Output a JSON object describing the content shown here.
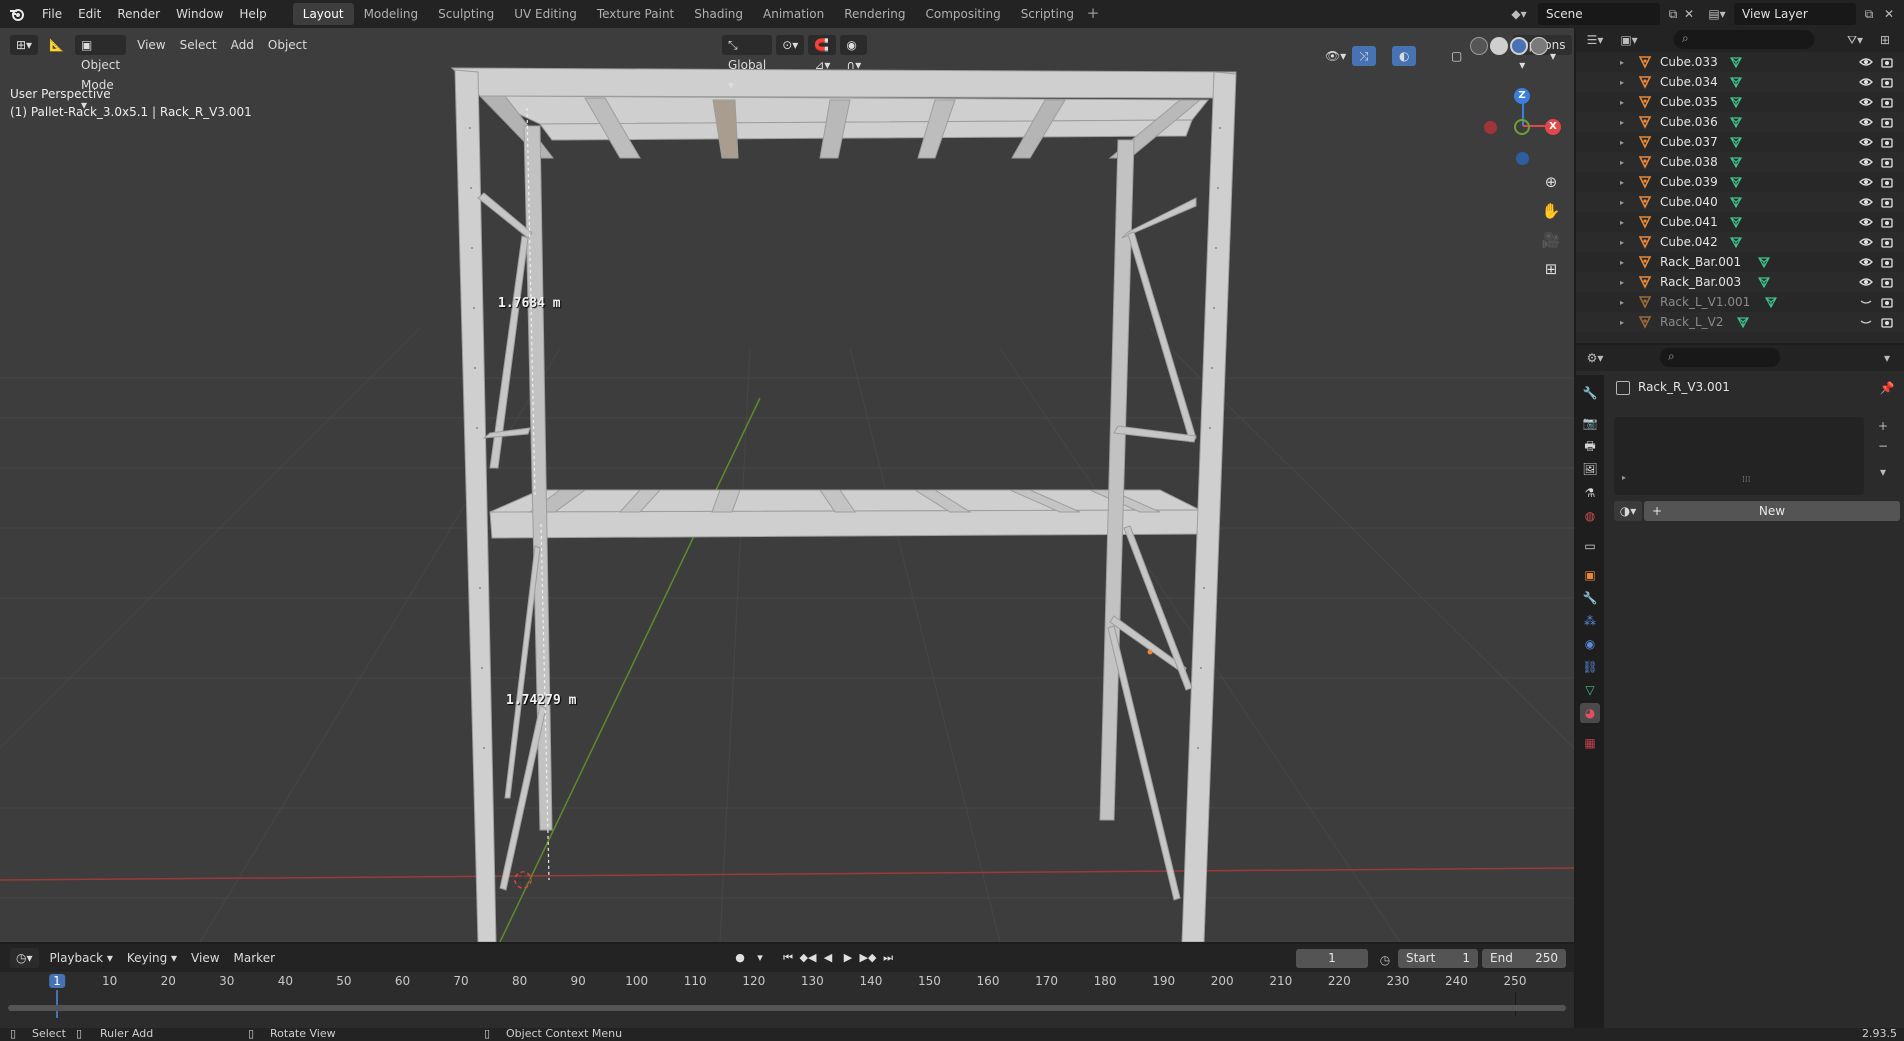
{
  "topbar": {
    "menus": [
      "File",
      "Edit",
      "Render",
      "Window",
      "Help"
    ],
    "workspaces": [
      "Layout",
      "Modeling",
      "Sculpting",
      "UV Editing",
      "Texture Paint",
      "Shading",
      "Animation",
      "Rendering",
      "Compositing",
      "Scripting"
    ],
    "active_workspace": "Layout",
    "scene_name": "Scene",
    "view_layer": "View Layer"
  },
  "viewport": {
    "mode": "Object Mode",
    "menus": [
      "View",
      "Select",
      "Add",
      "Object"
    ],
    "orientation": "Global",
    "options_label": "Options",
    "perspective_label": "User Perspective",
    "object_label": "(1) Pallet-Rack_3.0x5.1 | Rack_R_V3.001",
    "measure_top": "1.7684 m",
    "measure_bottom": "1.74279 m",
    "gizmo": {
      "z": "Z",
      "y": "Y",
      "x": "X"
    }
  },
  "outliner": {
    "search_placeholder": "",
    "rows": [
      {
        "name": "Cube.033",
        "dim": false
      },
      {
        "name": "Cube.034",
        "dim": false
      },
      {
        "name": "Cube.035",
        "dim": false
      },
      {
        "name": "Cube.036",
        "dim": false
      },
      {
        "name": "Cube.037",
        "dim": false
      },
      {
        "name": "Cube.038",
        "dim": false
      },
      {
        "name": "Cube.039",
        "dim": false
      },
      {
        "name": "Cube.040",
        "dim": false
      },
      {
        "name": "Cube.041",
        "dim": false
      },
      {
        "name": "Cube.042",
        "dim": false
      },
      {
        "name": "Rack_Bar.001",
        "dim": false
      },
      {
        "name": "Rack_Bar.003",
        "dim": false
      },
      {
        "name": "Rack_L_V1.001",
        "dim": true
      },
      {
        "name": "Rack_L_V2",
        "dim": true
      }
    ]
  },
  "properties": {
    "object_name": "Rack_R_V3.001",
    "new_label": "New"
  },
  "timeline": {
    "menus": [
      "Playback",
      "Keying",
      "View",
      "Marker"
    ],
    "current_frame": "1",
    "start_label": "Start",
    "start_value": "1",
    "end_label": "End",
    "end_value": "250",
    "frame_marks": [
      "1",
      "10",
      "20",
      "30",
      "40",
      "50",
      "60",
      "70",
      "80",
      "90",
      "100",
      "110",
      "120",
      "130",
      "140",
      "150",
      "160",
      "170",
      "180",
      "190",
      "200",
      "210",
      "220",
      "230",
      "240",
      "250"
    ]
  },
  "statusbar": {
    "select": "Select",
    "ruler_add": "Ruler Add",
    "rotate_view": "Rotate View",
    "context_menu": "Object Context Menu",
    "version": "2.93.5"
  },
  "colors": {
    "accent_blue": "#4772b3",
    "axis_x": "#e2484b",
    "axis_y": "#6ba331",
    "axis_z": "#3c7edb",
    "object_orange": "#e8883a",
    "mesh_green": "#3fc28b"
  }
}
